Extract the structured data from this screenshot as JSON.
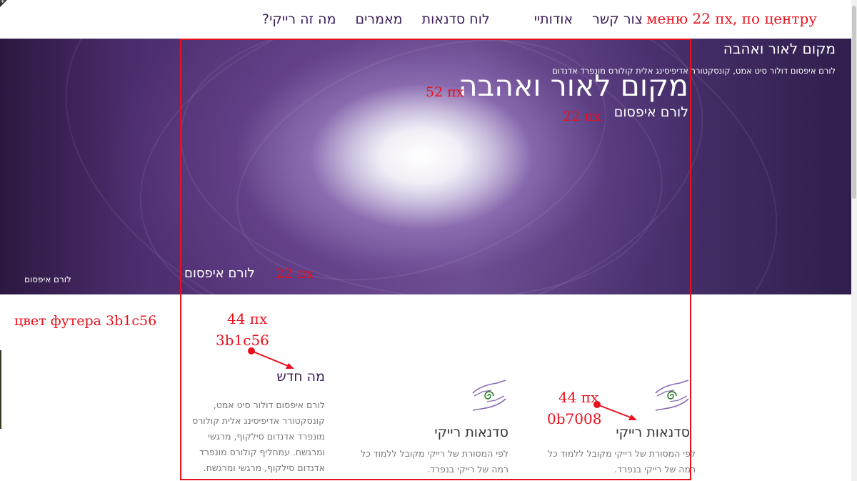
{
  "nav": {
    "items": [
      "מה זה רייקי?",
      "מאמרים",
      "לוח סדנאות",
      "אודותיי",
      "צור קשר"
    ],
    "corner_icon": "plus-icon"
  },
  "annotations": {
    "menu": "меню 22 пх, по центру",
    "title_size": "52 пх",
    "subtitle_size": "22 пх",
    "bottom_text_size": "22 пх",
    "footer_color_note": "цвет футера 3b1c56",
    "news_size": "44 пх",
    "news_color": "3b1c56",
    "card_size": "44 пх",
    "card_color": "0b7008"
  },
  "hero": {
    "small_title": "מקום לאור ואהבה",
    "small_subtitle": "לורם איפסום דולור סיט אמט, קונסקטורר אדיפיסינג אלית קולורס מונפרד אדנדום",
    "big_title": "מקום לאור ואהבה",
    "big_subtitle": "לורם איפסום",
    "bottom_right_text": "לורם איפסום",
    "bottom_left_text": "לורם איפסום"
  },
  "news": {
    "title": "מה חדש",
    "lines": [
      "לורם איפסום דולור סיט אמט,",
      "קונסקטורר אדיפיסינג אלית קולורס",
      "מונפרד אדנדום סילקוף, מרגשי",
      "ומרגשח. עמחליף קולורס מונפרד",
      "אדנדום סילקוף, מרגשי ומרגשח."
    ]
  },
  "cards": [
    {
      "title": "סדנאות רייקי",
      "lines": [
        "לפי המסורת של רייקי מקובל ללמוד כל",
        "רמה של רייקי בנפרד."
      ],
      "icon": "reiki-hands-icon"
    },
    {
      "title": "סדנאות רייקי",
      "lines": [
        "לפי המסורת של רייקי מקובל ללמוד כל",
        "רמה של רייקי בנפרד."
      ],
      "icon": "reiki-hands-icon"
    }
  ],
  "colors": {
    "brand": "#3b1c56",
    "annotation_red": "#e8101d",
    "card_icon_green": "#0b7008",
    "card_icon_purple": "#8a6ab0"
  }
}
